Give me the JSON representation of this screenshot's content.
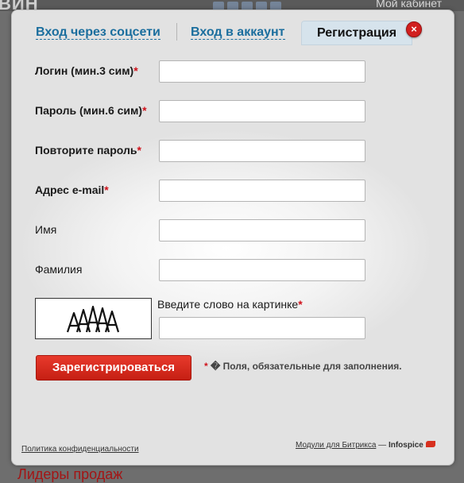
{
  "background": {
    "logo_fragment": "ВИН",
    "cabinet": "Мой кабинет",
    "bottom_text": "Лидеры продаж"
  },
  "tabs": {
    "social": "Вход через соцсети",
    "login": "Вход в аккаунт",
    "register": "Регистрация"
  },
  "close_icon": "×",
  "form": {
    "fields": [
      {
        "label": "Логин (мин.3 сим)",
        "required": "*",
        "value": ""
      },
      {
        "label": "Пароль (мин.6 сим)",
        "required": "*",
        "value": ""
      },
      {
        "label": "Повторите пароль",
        "required": "*",
        "value": ""
      },
      {
        "label": "Адрес e-mail",
        "required": "*",
        "value": ""
      },
      {
        "label": "Имя",
        "required": "",
        "value": ""
      },
      {
        "label": "Фамилия",
        "required": "",
        "value": ""
      }
    ],
    "captcha": {
      "label": "Введите слово на картинке",
      "required": "*",
      "value": ""
    },
    "submit": "Зарегистрироваться",
    "note_star": "*",
    "note": "� Поля, обязательные для заполнения."
  },
  "footer": {
    "privacy": "Политика конфиденциальности",
    "modules": "Модули для Битрикса",
    "dash": " — ",
    "brand": "Infospice"
  },
  "colors": {
    "link": "#1b6e9e",
    "required": "#d0121b",
    "button": "#d6281b",
    "active_tab": "#d6e3ec"
  }
}
